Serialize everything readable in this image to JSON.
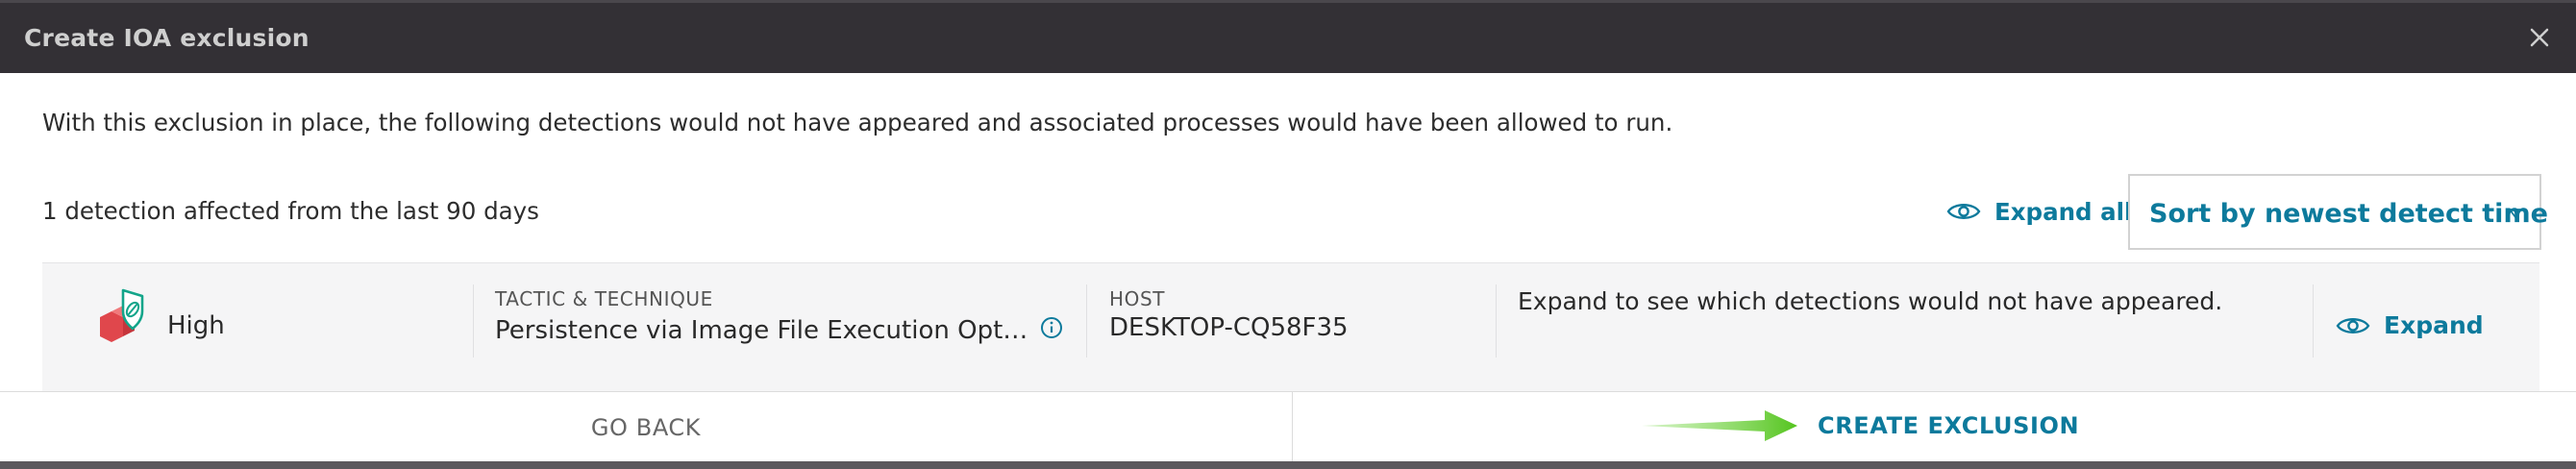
{
  "dialog": {
    "title": "Create IOA exclusion",
    "close_icon": "close-icon"
  },
  "intro_text": "With this exclusion in place, the following detections would not have appeared and associated processes would have been allowed to run.",
  "summary": {
    "count_text": "1 detection affected from the last 90 days",
    "expand_all_label": "Expand all",
    "expand_all_icon": "eye-icon",
    "sort_label": "Sort by newest detect time",
    "sort_icon": "chevron-down-icon"
  },
  "detection": {
    "severity": "High",
    "severity_icon": "severity-high-icon",
    "tactic_label": "TACTIC & TECHNIQUE",
    "tactic_value": "Persistence via Image File Execution Options",
    "host_label": "HOST",
    "host_value": "DESKTOP-CQ58F35",
    "hint": "Expand to see which detections would not have appeared.",
    "expand_label": "Expand",
    "expand_icon": "eye-icon"
  },
  "footer": {
    "back_label": "GO BACK",
    "create_label": "CREATE EXCLUSION",
    "arrow_icon": "arrow-right-icon"
  },
  "colors": {
    "accent": "#0d7a9c",
    "header_bg": "#333035",
    "row_bg": "#f5f5f6",
    "severity_red": "#e0474c",
    "shield_green": "#13a58a",
    "arrow_green": "#55c41f"
  }
}
